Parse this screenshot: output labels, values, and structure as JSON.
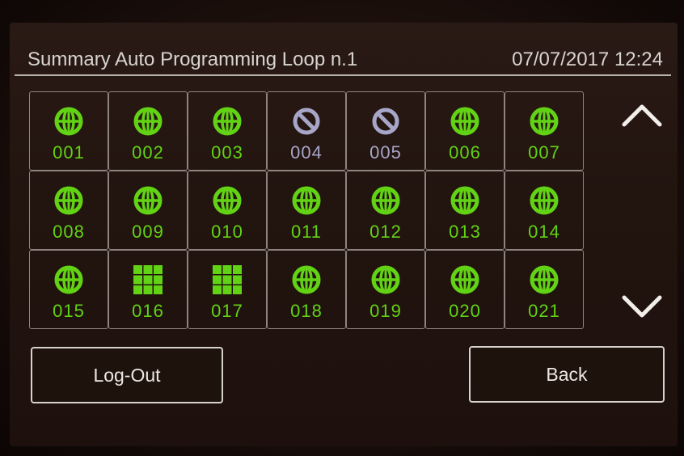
{
  "header": {
    "title": "Summary Auto Programming Loop n.1",
    "datetime": "07/07/2017 12:24"
  },
  "devices": [
    {
      "number": "001",
      "icon": "globe-icon"
    },
    {
      "number": "002",
      "icon": "globe-icon"
    },
    {
      "number": "003",
      "icon": "globe-icon"
    },
    {
      "number": "004",
      "icon": "disabled-icon"
    },
    {
      "number": "005",
      "icon": "disabled-icon"
    },
    {
      "number": "006",
      "icon": "globe-icon"
    },
    {
      "number": "007",
      "icon": "globe-icon"
    },
    {
      "number": "008",
      "icon": "globe-icon"
    },
    {
      "number": "009",
      "icon": "globe-icon"
    },
    {
      "number": "010",
      "icon": "globe-icon"
    },
    {
      "number": "011",
      "icon": "globe-icon"
    },
    {
      "number": "012",
      "icon": "globe-icon"
    },
    {
      "number": "013",
      "icon": "globe-icon"
    },
    {
      "number": "014",
      "icon": "globe-icon"
    },
    {
      "number": "015",
      "icon": "globe-icon"
    },
    {
      "number": "016",
      "icon": "grid-icon"
    },
    {
      "number": "017",
      "icon": "grid-icon"
    },
    {
      "number": "018",
      "icon": "globe-icon"
    },
    {
      "number": "019",
      "icon": "globe-icon"
    },
    {
      "number": "020",
      "icon": "globe-icon"
    },
    {
      "number": "021",
      "icon": "globe-icon"
    }
  ],
  "navigation": {
    "up_icon": "chevron-up-icon",
    "down_icon": "chevron-down-icon"
  },
  "buttons": {
    "logout_label": "Log-Out",
    "back_label": "Back"
  },
  "colors": {
    "active_green": "#62d314",
    "disabled_blue": "#a8a6c8",
    "text_light": "#d8d4cf"
  }
}
